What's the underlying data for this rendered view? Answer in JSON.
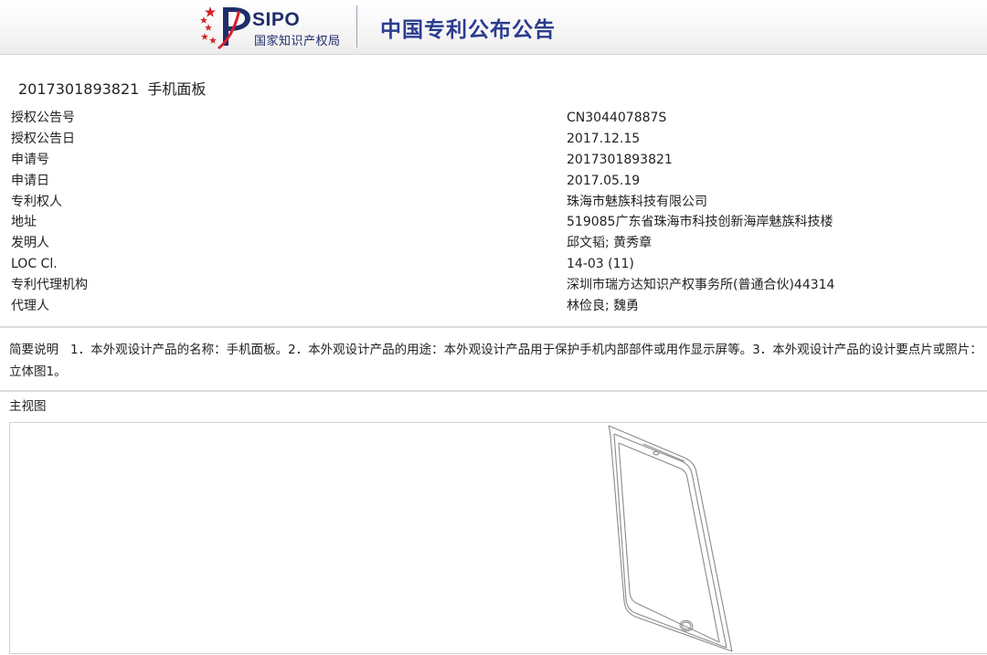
{
  "header": {
    "logo_text": "SIPO",
    "logo_subtitle": "国家知识产权局",
    "site_title": "中国专利公布公告"
  },
  "document": {
    "application_number": "2017301893821",
    "product_name": "手机面板"
  },
  "fields": [
    {
      "label": "授权公告号",
      "value": "CN304407887S"
    },
    {
      "label": "授权公告日",
      "value": "2017.12.15"
    },
    {
      "label": "申请号",
      "value": "2017301893821"
    },
    {
      "label": "申请日",
      "value": "2017.05.19"
    },
    {
      "label": "专利权人",
      "value": "珠海市魅族科技有限公司"
    },
    {
      "label": "地址",
      "value": "519085广东省珠海市科技创新海岸魅族科技楼"
    },
    {
      "label": "发明人",
      "value": "邱文韬; 黄秀章"
    },
    {
      "label": "LOC Cl.",
      "value": "14-03 (11)"
    },
    {
      "label": "专利代理机构",
      "value": "深圳市瑞方达知识产权事务所(普通合伙)44314"
    },
    {
      "label": "代理人",
      "value": "林俭良; 魏勇"
    }
  ],
  "summary": {
    "label": "简要说明",
    "text": "1．本外观设计产品的名称：手机面板。2．本外观设计产品的用途：本外观设计产品用于保护手机内部部件或用作显示屏等。3．本外观设计产品的设计要点片或照片：立体图1。"
  },
  "view": {
    "label": "主视图"
  }
}
